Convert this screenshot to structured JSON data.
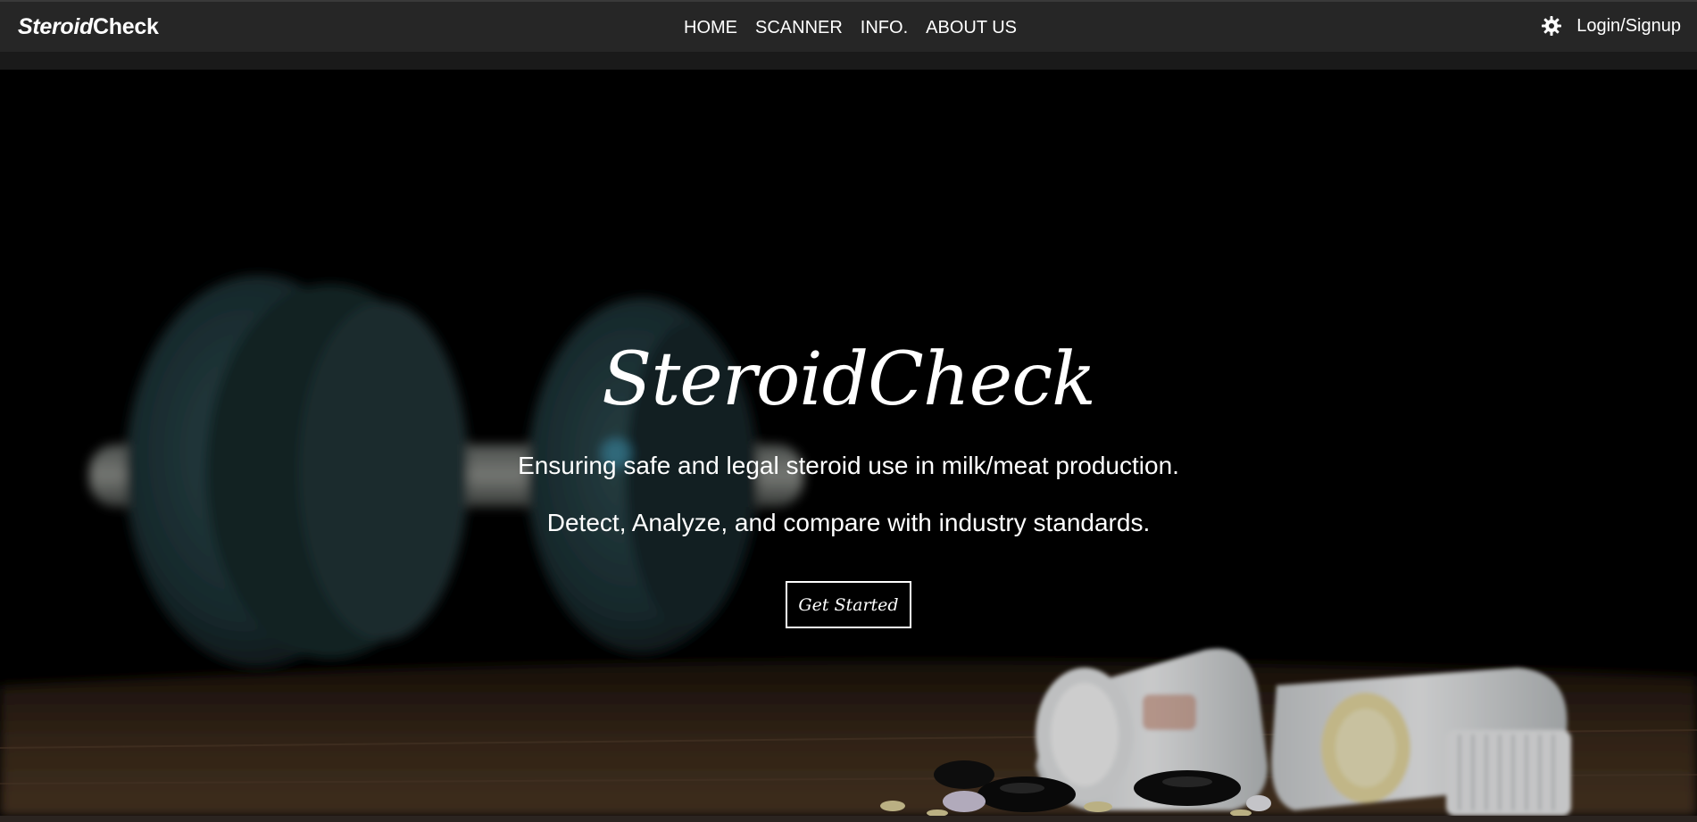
{
  "navbar": {
    "brand_italic": "Steroid",
    "brand_bold": "Check",
    "links": [
      "HOME",
      "SCANNER",
      "INFO.",
      "ABOUT US"
    ],
    "settings_icon": "gear-icon",
    "login_label": "Login/Signup"
  },
  "hero": {
    "title": "SteroidCheck",
    "subtitle_1": "Ensuring safe and legal steroid use in milk/meat production.",
    "subtitle_2": "Detect, Analyze, and compare with industry standards.",
    "cta_label": "Get Started"
  },
  "colors": {
    "navbar_bg": "#262626",
    "hero_bg": "#000000",
    "text": "#ffffff"
  }
}
